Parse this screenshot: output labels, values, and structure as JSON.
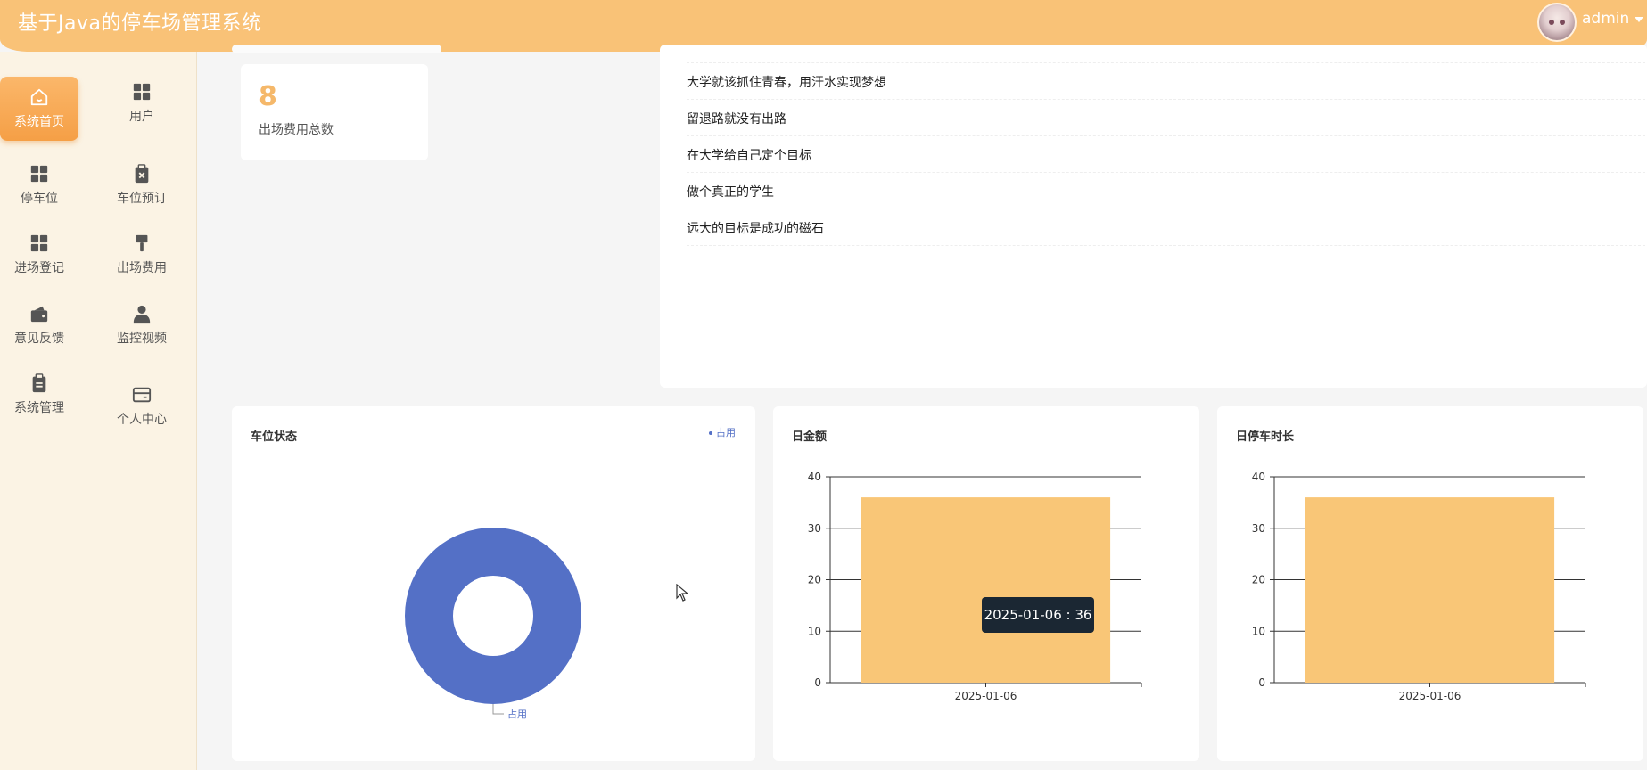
{
  "header": {
    "title": "基于Java的停车场管理系统",
    "username": "admin"
  },
  "sidebar": {
    "items": [
      {
        "label": "系统首页",
        "icon": "home-icon",
        "active": true
      },
      {
        "label": "用户",
        "icon": "grid-icon"
      },
      {
        "label": "停车位",
        "icon": "grid-icon"
      },
      {
        "label": "车位预订",
        "icon": "clipboard-x-icon"
      },
      {
        "label": "进场登记",
        "icon": "grid-icon"
      },
      {
        "label": "出场费用",
        "icon": "brush-icon"
      },
      {
        "label": "意见反馈",
        "icon": "wallet-icon"
      },
      {
        "label": "监控视频",
        "icon": "user-icon"
      },
      {
        "label": "系统管理",
        "icon": "clipboard-icon"
      },
      {
        "label": "个人中心",
        "icon": "card-icon"
      }
    ]
  },
  "stat": {
    "value": "8",
    "label": "出场费用总数"
  },
  "mottos": [
    "大学就该抓住青春，用汗水实现梦想",
    "留退路就没有出路",
    "在大学给自己定个目标",
    "做个真正的学生",
    "远大的目标是成功的磁石"
  ],
  "colors": {
    "accent": "#f9c277",
    "series_pie": "#5470c6",
    "bar": "#f9c677"
  },
  "chart_data": [
    {
      "type": "pie",
      "title": "车位状态",
      "legend": [
        "占用"
      ],
      "legend_position": "top-right",
      "slices": [
        {
          "name": "占用",
          "value": 1
        }
      ],
      "donut": true
    },
    {
      "type": "bar",
      "title": "日金额",
      "categories": [
        "2025-01-06"
      ],
      "values": [
        36
      ],
      "ylim": [
        0,
        40
      ],
      "yticks": [
        0,
        10,
        20,
        30,
        40
      ],
      "grid": true,
      "tooltip": "2025-01-06 : 36"
    },
    {
      "type": "bar",
      "title": "日停车时长",
      "categories": [
        "2025-01-06"
      ],
      "values": [
        36
      ],
      "ylim": [
        0,
        40
      ],
      "yticks": [
        0,
        10,
        20,
        30,
        40
      ],
      "grid": true
    }
  ]
}
